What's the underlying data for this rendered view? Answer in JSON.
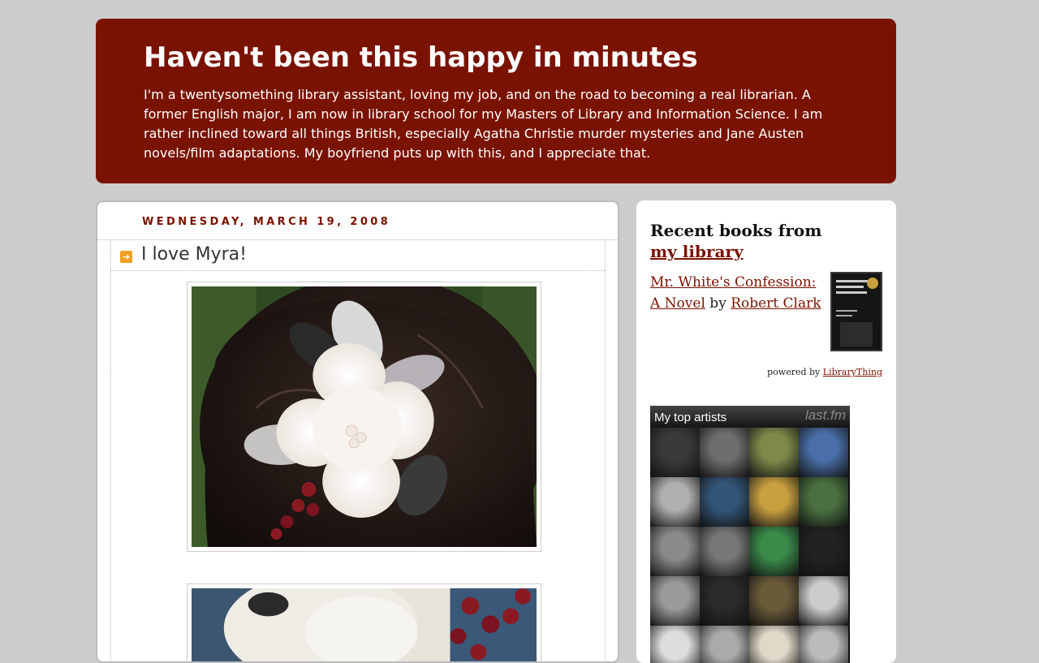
{
  "blog": {
    "title": "Haven't been this happy in minutes",
    "description": "I'm a twentysomething library assistant, loving my job, and on the road to becoming a real librarian. A former English major, I am now in library school for my Masters of Library and Information Science. I am rather inclined toward all things British, especially Agatha Christie murder mysteries and Jane Austen novels/film adaptations. My boyfriend puts up with this, and I appreciate that."
  },
  "post": {
    "date": "WEDNESDAY, MARCH 19, 2008",
    "title": "I love Myra!"
  },
  "sidebar": {
    "books_widget": {
      "title_prefix": "Recent books from ",
      "title_link": "my library",
      "book_title": "Mr. White's Confession: A Novel",
      "by": " by ",
      "author": "Robert Clark",
      "powered_prefix": "powered by ",
      "powered_link": "LibraryThing"
    },
    "lastfm": {
      "title": "My top artists",
      "logo": "last.fm",
      "tile_colors": [
        "#3a3a3a",
        "#6e6e6e",
        "#7d8a4a",
        "#4a6fa8",
        "#b0b0b0",
        "#335577",
        "#c8a040",
        "#4a7040",
        "#8a8a8a",
        "#777777",
        "#3a8a4a",
        "#222222",
        "#9a9a9a",
        "#2a2a2a",
        "#6a5a3a",
        "#cccccc",
        "#dddddd",
        "#aaaaaa",
        "#e0d8c8",
        "#bbbbbb"
      ]
    }
  },
  "colors": {
    "header_bg": "#7a1200",
    "accent": "#7a1200",
    "page_bg": "#cccccc"
  }
}
